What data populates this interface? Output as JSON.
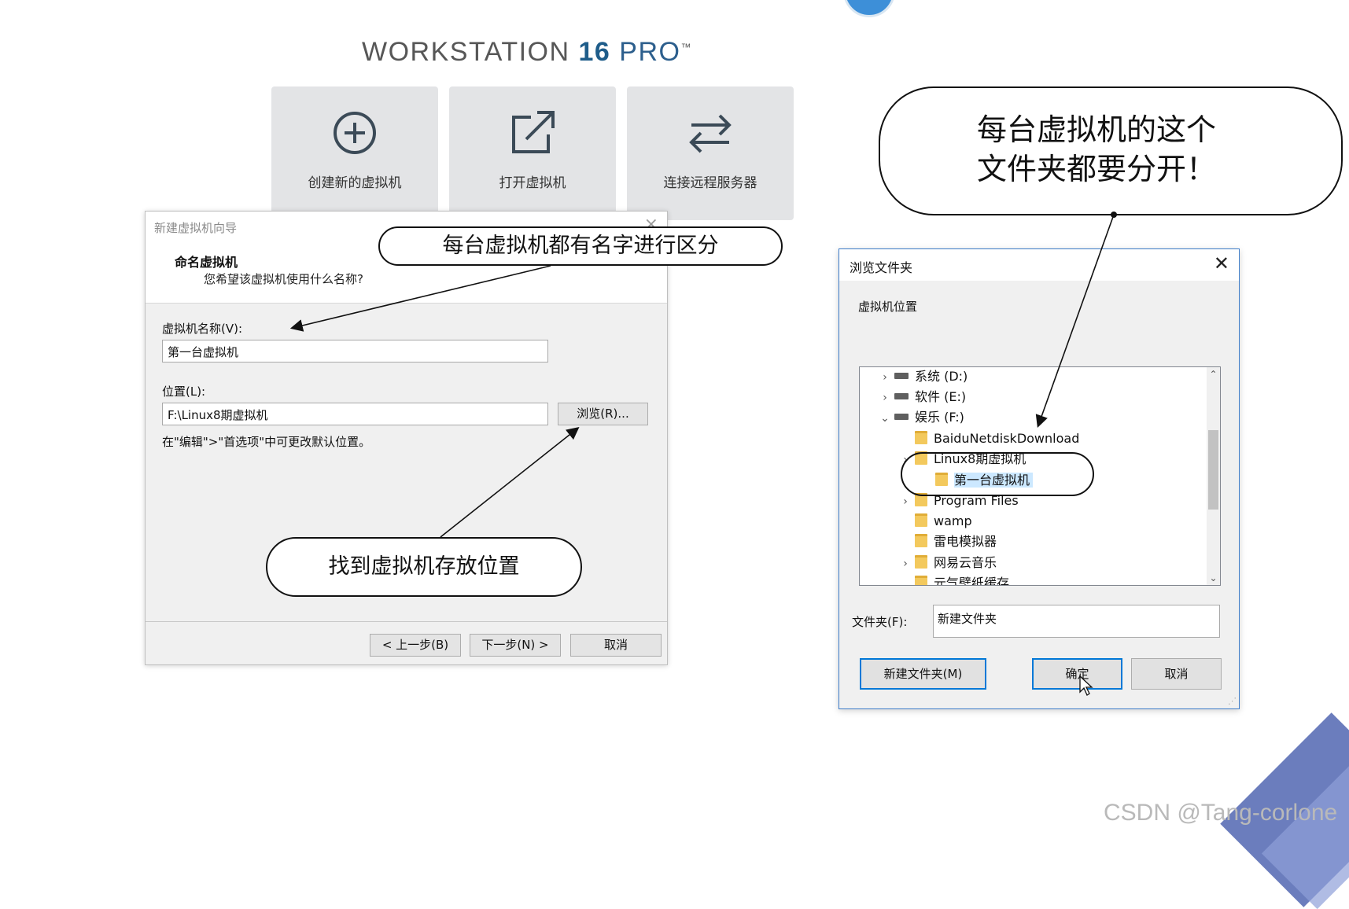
{
  "workstation": {
    "title_main": "WORKSTATION ",
    "title_version": "16",
    "title_pro": " PRO",
    "title_tm": "™",
    "tiles": [
      {
        "label": "创建新的虚拟机",
        "icon": "plus-circle-icon"
      },
      {
        "label": "打开虚拟机",
        "icon": "open-external-icon"
      },
      {
        "label": "连接远程服务器",
        "icon": "swap-arrows-icon"
      }
    ]
  },
  "wizard": {
    "window_title": "新建虚拟机向导",
    "close_glyph": "×",
    "heading": "命名虚拟机",
    "subheading": "您希望该虚拟机使用什么名称?",
    "name_label": "虚拟机名称(V):",
    "name_value": "第一台虚拟机",
    "location_label": "位置(L):",
    "location_value": "F:\\Linux8期虚拟机",
    "browse_button": "浏览(R)...",
    "hint": "在\"编辑\">\"首选项\"中可更改默认位置。",
    "back_button": "< 上一步(B)",
    "next_button": "下一步(N) >",
    "cancel_button": "取消"
  },
  "callouts": {
    "name": "每台虚拟机都有名字进行区分",
    "location": "找到虚拟机存放位置",
    "folder_line1": "每台虚拟机的这个",
    "folder_line2": "文件夹都要分开！"
  },
  "browse_dialog": {
    "window_title": "浏览文件夹",
    "close_glyph": "✕",
    "location_label": "虚拟机位置",
    "tree": [
      {
        "label": "系统 (D:)",
        "type": "drive",
        "chevron": "›"
      },
      {
        "label": "软件 (E:)",
        "type": "drive",
        "chevron": "›"
      },
      {
        "label": "娱乐 (F:)",
        "type": "drive",
        "chevron": "⌄"
      },
      {
        "label": "BaiduNetdiskDownload",
        "type": "folder",
        "chevron": ""
      },
      {
        "label": "Linux8期虚拟机",
        "type": "folder",
        "chevron": "›"
      },
      {
        "label": "第一台虚拟机",
        "type": "folder",
        "chevron": "",
        "selected": true
      },
      {
        "label": "Program Files",
        "type": "folder",
        "chevron": "›"
      },
      {
        "label": "wamp",
        "type": "folder",
        "chevron": ""
      },
      {
        "label": "雷电模拟器",
        "type": "folder",
        "chevron": ""
      },
      {
        "label": "网易云音乐",
        "type": "folder",
        "chevron": "›"
      },
      {
        "label": "元气壁纸缓存",
        "type": "folder",
        "chevron": ""
      }
    ],
    "scroll_up": "⌃",
    "scroll_down": "⌄",
    "folder_label": "文件夹(F):",
    "folder_value": "新建文件夹",
    "new_folder_button": "新建文件夹(M)",
    "ok_button": "确定",
    "cancel_button": "取消"
  },
  "watermark": "CSDN @Tang-corlone"
}
